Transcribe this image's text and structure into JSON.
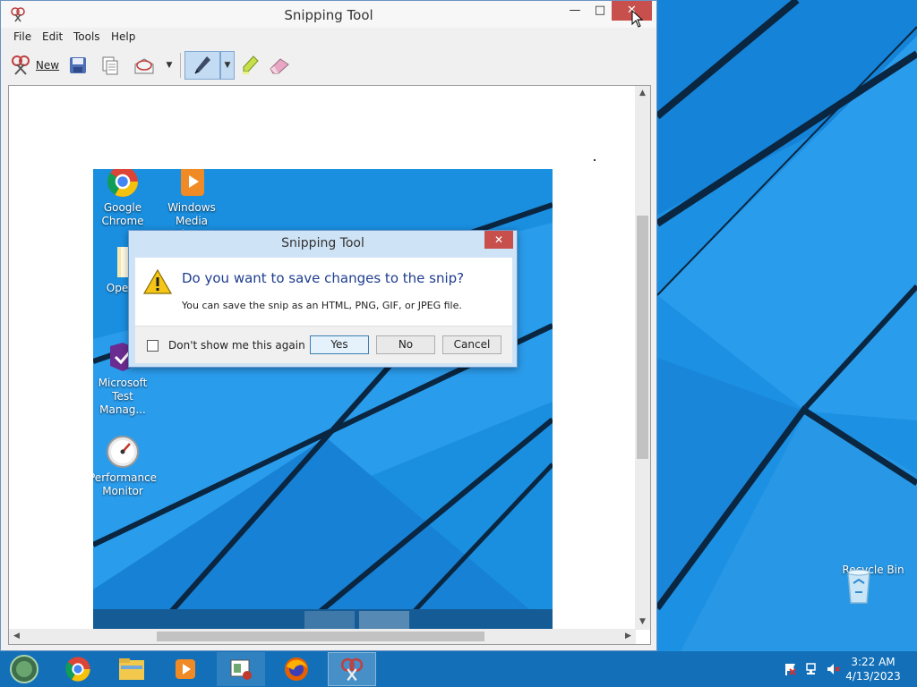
{
  "desktop": {
    "icons": [
      {
        "label": "Recycle Bin",
        "icon": "recycle-bin-icon"
      }
    ]
  },
  "window": {
    "title": "Snipping Tool",
    "menu": [
      "File",
      "Edit",
      "Tools",
      "Help"
    ],
    "toolbar": {
      "new_label": "New"
    }
  },
  "snip": {
    "icons": [
      {
        "label": "Google Chrome",
        "icon": "chrome-icon"
      },
      {
        "label": "Windows Media Player",
        "icon": "media-player-icon"
      },
      {
        "label": "Open-",
        "icon": "folder-icon"
      },
      {
        "label": "Microsoft Test Manag...",
        "icon": "test-manager-icon"
      },
      {
        "label": "Performance Monitor",
        "icon": "performance-monitor-icon"
      }
    ]
  },
  "dialog": {
    "title": "Snipping Tool",
    "heading": "Do you want to save changes to the snip?",
    "text": "You can save the snip as an HTML, PNG, GIF, or JPEG file.",
    "checkbox_label": "Don't show me this again",
    "yes": "Yes",
    "no": "No",
    "cancel": "Cancel"
  },
  "taskbar": {
    "apps": [
      {
        "name": "start",
        "icon": "start-orb-icon"
      },
      {
        "name": "chrome",
        "icon": "chrome-icon"
      },
      {
        "name": "explorer",
        "icon": "file-explorer-icon"
      },
      {
        "name": "media-player",
        "icon": "media-player-icon"
      },
      {
        "name": "test-manager",
        "icon": "test-manager-icon"
      },
      {
        "name": "firefox",
        "icon": "firefox-icon"
      },
      {
        "name": "snipping-tool",
        "icon": "snipping-tool-icon"
      }
    ],
    "time": "3:22 AM",
    "date": "4/13/2023"
  },
  "colors": {
    "desktop_blue": "#1a8fe0",
    "taskbar_blue": "#1370b8",
    "close_red": "#c7504c",
    "heading_blue": "#1e3d8f"
  }
}
